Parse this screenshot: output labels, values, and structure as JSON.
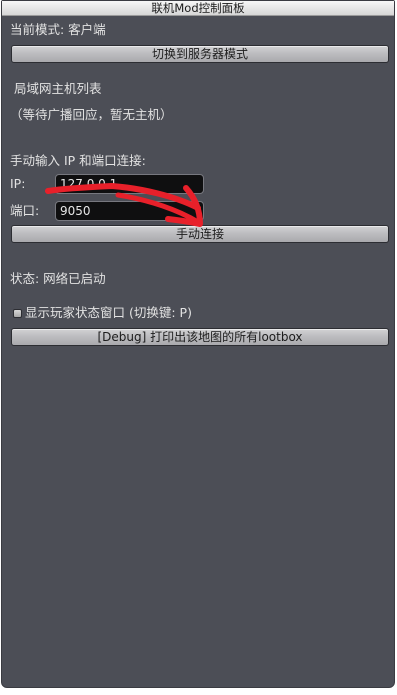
{
  "window": {
    "title": "联机Mod控制面板"
  },
  "mode": {
    "label": "当前模式: 客户端",
    "switch_button": "切换到服务器模式"
  },
  "lan": {
    "heading": "局域网主机列表",
    "empty_message": "（等待广播回应，暂无主机）"
  },
  "manual": {
    "heading": "手动输入 IP 和端口连接:",
    "ip_label": "IP:",
    "ip_value": "127.0.0.1",
    "port_label": "端口:",
    "port_value": "9050",
    "connect_button": "手动连接"
  },
  "status": {
    "text": "状态: 网络已启动"
  },
  "options": {
    "show_status_checkbox_label": "显示玩家状态窗口 (切换键: P)",
    "show_status_checked": false,
    "debug_button": "[Debug] 打印出该地图的所有lootbox"
  },
  "annotation": {
    "color": "#e8202a",
    "icon": "red-arrow-scribble"
  }
}
